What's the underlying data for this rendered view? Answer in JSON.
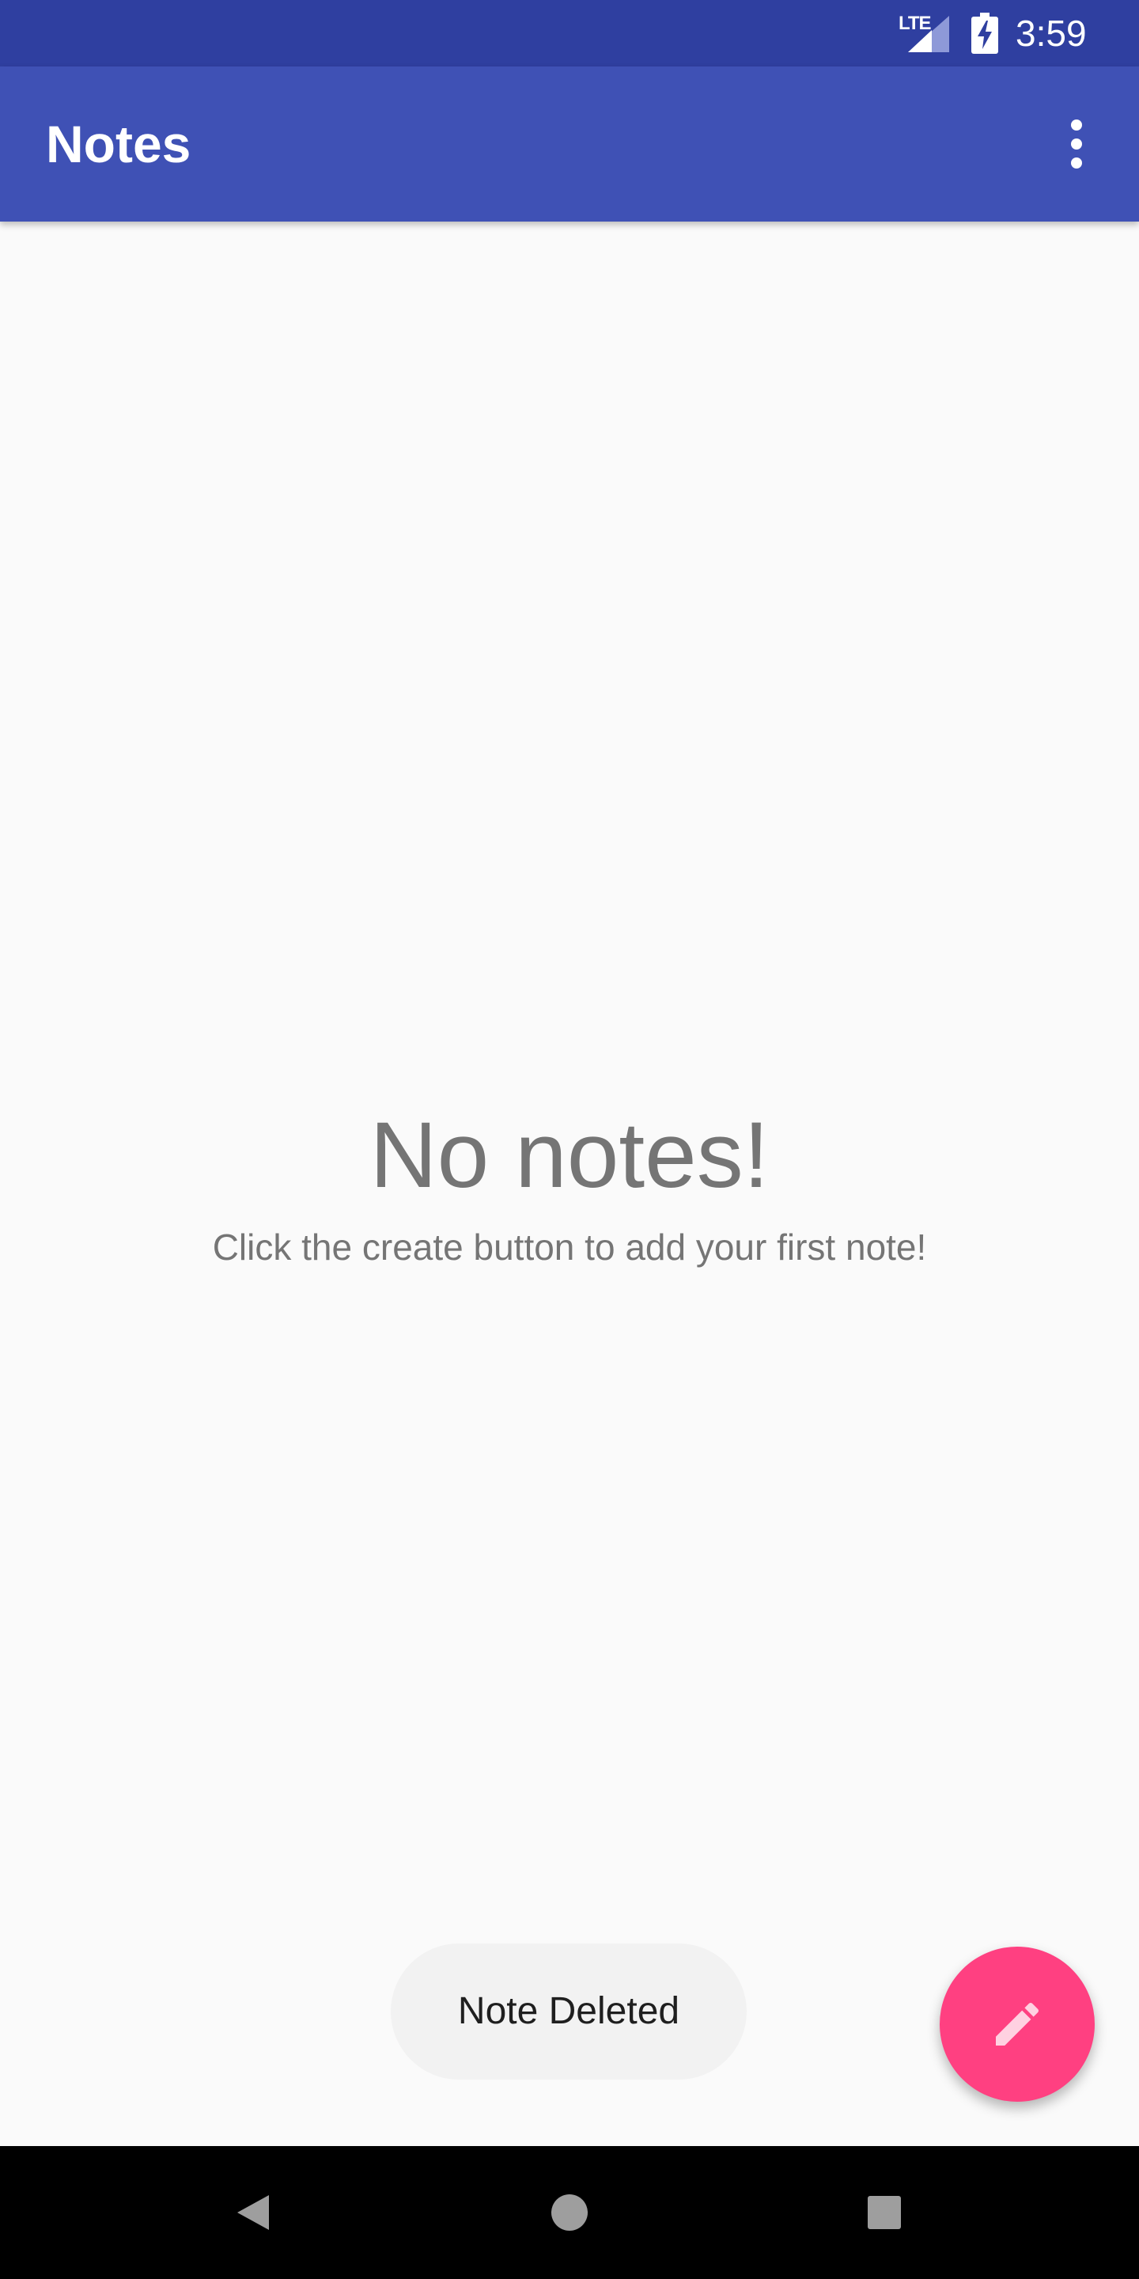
{
  "status_bar": {
    "network_label": "LTE",
    "time": "3:59",
    "icons": [
      "lte-signal-icon",
      "battery-charging-icon"
    ]
  },
  "app_bar": {
    "title": "Notes",
    "overflow_icon": "more-vert-icon"
  },
  "empty_state": {
    "title": "No notes!",
    "subtitle": "Click the create button to add your first note!"
  },
  "toast": {
    "message": "Note Deleted"
  },
  "fab": {
    "icon": "pencil-icon",
    "color": "#ff4081"
  },
  "nav_bar": {
    "icons": [
      "back-icon",
      "home-icon",
      "recents-icon"
    ]
  },
  "colors": {
    "status_bar": "#2f3fa0",
    "app_bar": "#3f51b5",
    "accent": "#ff4081",
    "background": "#fafafa",
    "muted_text": "#757575"
  }
}
